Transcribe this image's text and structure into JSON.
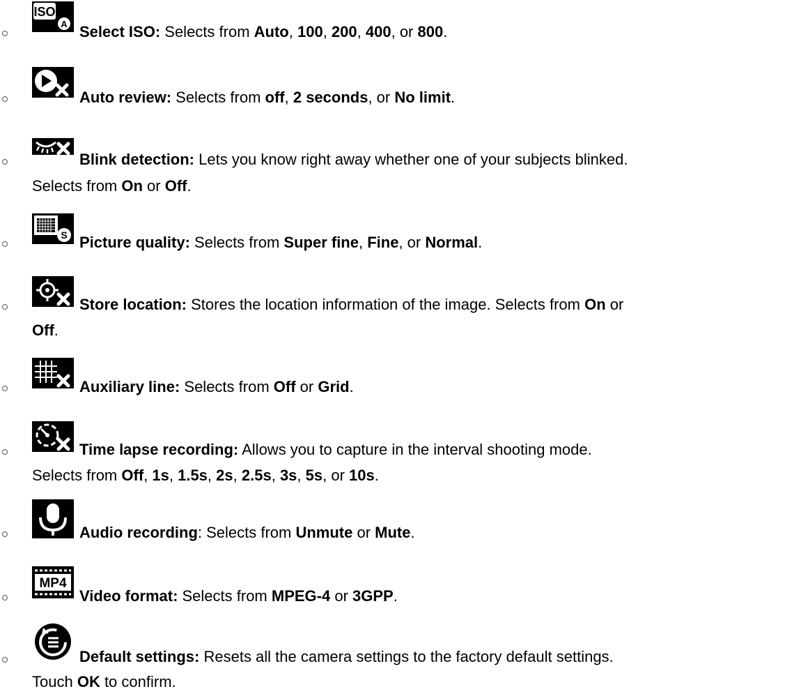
{
  "items": [
    {
      "icon": "iso-auto-icon",
      "label": "Select ISO:",
      "text": [
        {
          "t": " Selects from ",
          "b": false
        },
        {
          "t": "Auto",
          "b": true
        },
        {
          "t": ", ",
          "b": false
        },
        {
          "t": "100",
          "b": true
        },
        {
          "t": ", ",
          "b": false
        },
        {
          "t": "200",
          "b": true
        },
        {
          "t": ", ",
          "b": false
        },
        {
          "t": "400",
          "b": true
        },
        {
          "t": ", or ",
          "b": false
        },
        {
          "t": "800",
          "b": true
        },
        {
          "t": ".",
          "b": false
        }
      ],
      "line2": []
    },
    {
      "icon": "auto-review-icon",
      "label": "Auto review:",
      "text": [
        {
          "t": " Selects from ",
          "b": false
        },
        {
          "t": "off",
          "b": true
        },
        {
          "t": ", ",
          "b": false
        },
        {
          "t": "2 seconds",
          "b": true
        },
        {
          "t": ", or ",
          "b": false
        },
        {
          "t": "No limit",
          "b": true
        },
        {
          "t": ".",
          "b": false
        }
      ],
      "line2": []
    },
    {
      "icon": "blink-detection-icon",
      "label": "Blink detection:",
      "text": [
        {
          "t": " Lets you know right away whether one of your subjects blinked.",
          "b": false
        }
      ],
      "line2": [
        {
          "t": "Selects from ",
          "b": false
        },
        {
          "t": "On",
          "b": true
        },
        {
          "t": " or ",
          "b": false
        },
        {
          "t": "Off",
          "b": true
        },
        {
          "t": ".",
          "b": false
        }
      ]
    },
    {
      "icon": "picture-quality-icon",
      "label": "Picture quality:",
      "text": [
        {
          "t": " Selects from ",
          "b": false
        },
        {
          "t": "Super fine",
          "b": true
        },
        {
          "t": ", ",
          "b": false
        },
        {
          "t": "Fine",
          "b": true
        },
        {
          "t": ", or ",
          "b": false
        },
        {
          "t": "Normal",
          "b": true
        },
        {
          "t": ".",
          "b": false
        }
      ],
      "line2": []
    },
    {
      "icon": "store-location-icon",
      "label": "Store location:",
      "text": [
        {
          "t": " Stores the location information of the image. Selects from ",
          "b": false
        },
        {
          "t": "On",
          "b": true
        },
        {
          "t": " or",
          "b": false
        }
      ],
      "line2": [
        {
          "t": "Off",
          "b": true
        },
        {
          "t": ".",
          "b": false
        }
      ]
    },
    {
      "icon": "auxiliary-line-icon",
      "label": "Auxiliary line:",
      "text": [
        {
          "t": " Selects from ",
          "b": false
        },
        {
          "t": "Off",
          "b": true
        },
        {
          "t": " or ",
          "b": false
        },
        {
          "t": "Grid",
          "b": true
        },
        {
          "t": ".",
          "b": false
        }
      ],
      "line2": []
    },
    {
      "icon": "time-lapse-icon",
      "label": "Time lapse recording:",
      "text": [
        {
          "t": " Allows you to capture in the interval shooting mode.",
          "b": false
        }
      ],
      "line2": [
        {
          "t": "Selects from ",
          "b": false
        },
        {
          "t": "Off",
          "b": true
        },
        {
          "t": ", ",
          "b": false
        },
        {
          "t": "1s",
          "b": true
        },
        {
          "t": ", ",
          "b": false
        },
        {
          "t": "1.5s",
          "b": true
        },
        {
          "t": ", ",
          "b": false
        },
        {
          "t": "2s",
          "b": true
        },
        {
          "t": ", ",
          "b": false
        },
        {
          "t": "2.5s",
          "b": true
        },
        {
          "t": ", ",
          "b": false
        },
        {
          "t": "3s",
          "b": true
        },
        {
          "t": ", ",
          "b": false
        },
        {
          "t": "5s",
          "b": true
        },
        {
          "t": ", or ",
          "b": false
        },
        {
          "t": "10s",
          "b": true
        },
        {
          "t": ".",
          "b": false
        }
      ]
    },
    {
      "icon": "microphone-icon",
      "label": "Audio recording",
      "text": [
        {
          "t": ": Selects from ",
          "b": false
        },
        {
          "t": "Unmute",
          "b": true
        },
        {
          "t": " or ",
          "b": false
        },
        {
          "t": "Mute",
          "b": true
        },
        {
          "t": ".",
          "b": false
        }
      ],
      "line2": []
    },
    {
      "icon": "mp4-video-format-icon",
      "icon_text": "MP4",
      "label": "Video format:",
      "text": [
        {
          "t": " Selects from ",
          "b": false
        },
        {
          "t": "MPEG-4",
          "b": true
        },
        {
          "t": " or ",
          "b": false
        },
        {
          "t": "3GPP",
          "b": true
        },
        {
          "t": ".",
          "b": false
        }
      ],
      "line2": []
    },
    {
      "icon": "default-settings-reset-icon",
      "label": "Default settings:",
      "text": [
        {
          "t": " Resets all the camera settings to the factory default settings.",
          "b": false
        }
      ],
      "line2": [
        {
          "t": "Touch ",
          "b": false
        },
        {
          "t": "OK",
          "b": true
        },
        {
          "t": " to confirm.",
          "b": false
        }
      ]
    }
  ],
  "iso_icon_text": "ISO",
  "iso_icon_badge": "A",
  "quality_icon_badge": "S"
}
